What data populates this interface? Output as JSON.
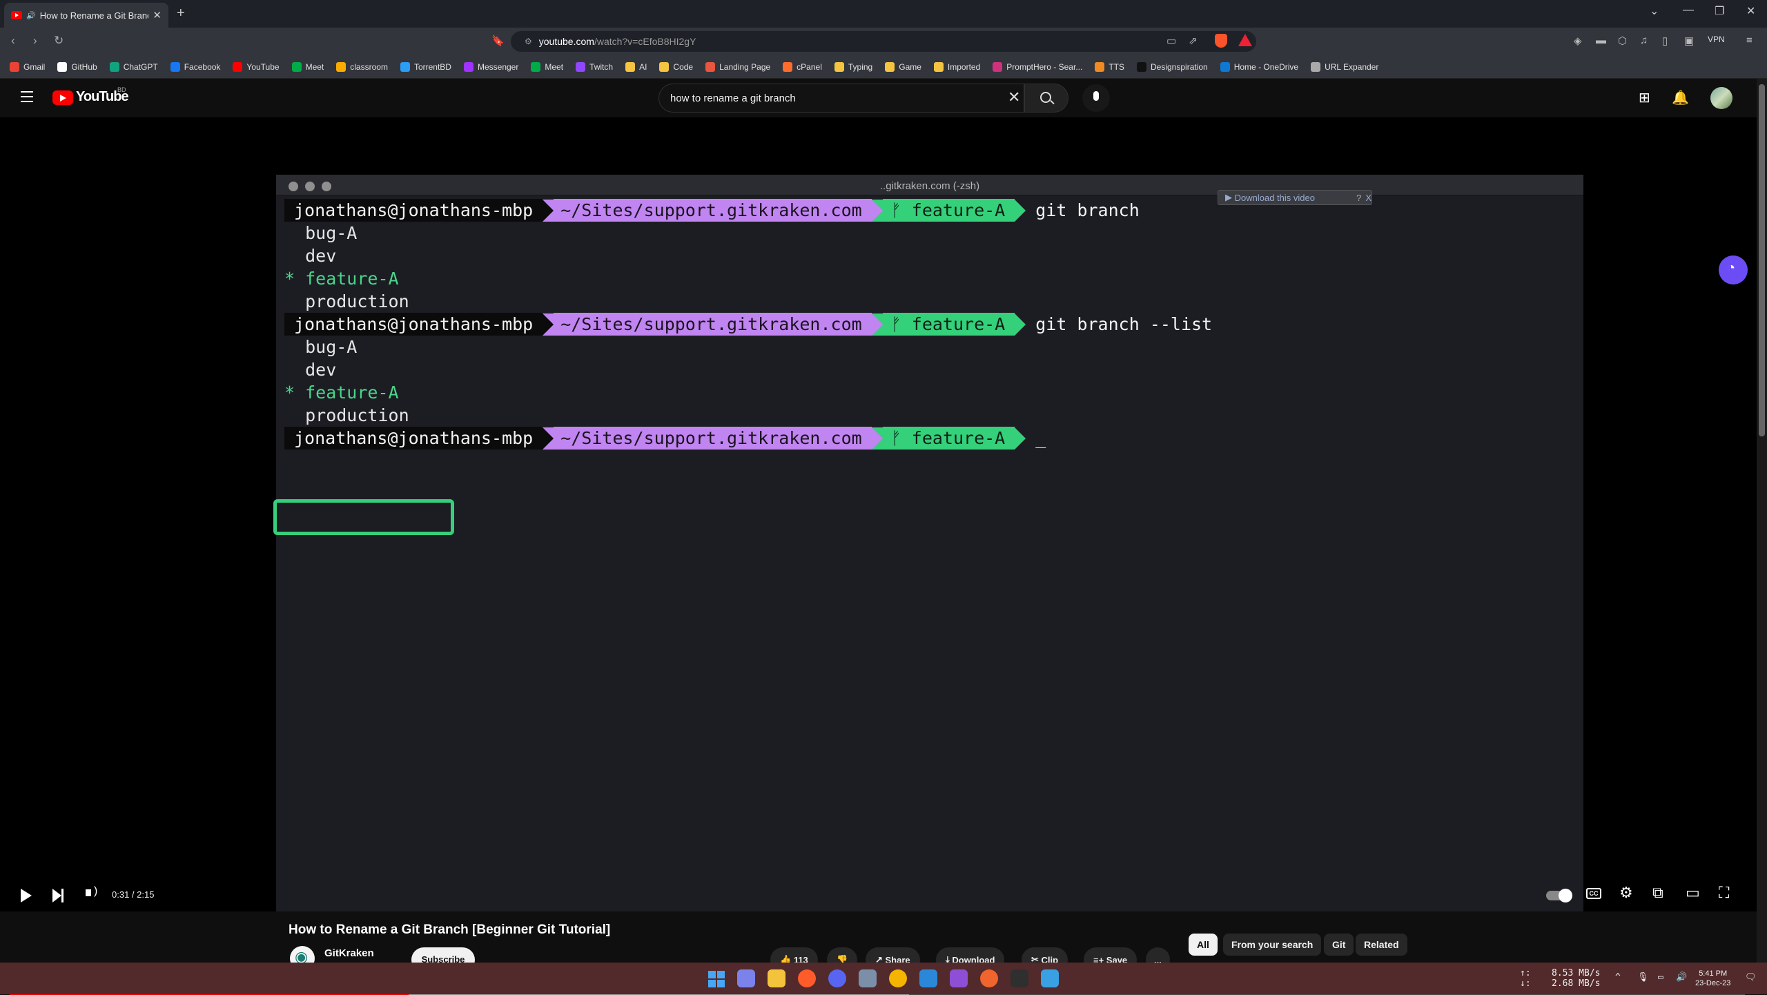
{
  "browser": {
    "tab_title": "How to Rename a Git Branch",
    "tab_audio_icon": "speaker-icon",
    "url_host": "youtube.com",
    "url_path": "/watch?v=cEfoB8HI2gY",
    "vpn_label": "VPN",
    "bookmarks": [
      {
        "label": "Gmail",
        "icon": "gmail-icon",
        "color": "#ea4335"
      },
      {
        "label": "GitHub",
        "icon": "github-icon",
        "color": "#ffffff"
      },
      {
        "label": "ChatGPT",
        "icon": "chatgpt-icon",
        "color": "#10a37f"
      },
      {
        "label": "Facebook",
        "icon": "facebook-icon",
        "color": "#1877f2"
      },
      {
        "label": "YouTube",
        "icon": "youtube-icon",
        "color": "#ff0000"
      },
      {
        "label": "Meet",
        "icon": "meet-icon",
        "color": "#00ac47"
      },
      {
        "label": "classroom",
        "icon": "classroom-icon",
        "color": "#f9ab00"
      },
      {
        "label": "TorrentBD",
        "icon": "torrentbd-icon",
        "color": "#2a9df4"
      },
      {
        "label": "Messenger",
        "icon": "messenger-icon",
        "color": "#a033ff"
      },
      {
        "label": "Meet",
        "icon": "meet-icon",
        "color": "#00ac47"
      },
      {
        "label": "Twitch",
        "icon": "twitch-icon",
        "color": "#9146ff"
      },
      {
        "label": "AI",
        "icon": "folder-icon",
        "color": "#f5c542"
      },
      {
        "label": "Code",
        "icon": "folder-icon",
        "color": "#f5c542"
      },
      {
        "label": "Landing Page",
        "icon": "landing-icon",
        "color": "#e8563f"
      },
      {
        "label": "cPanel",
        "icon": "cpanel-icon",
        "color": "#ff6c2c"
      },
      {
        "label": "Typing",
        "icon": "folder-icon",
        "color": "#f5c542"
      },
      {
        "label": "Game",
        "icon": "folder-icon",
        "color": "#f5c542"
      },
      {
        "label": "Imported",
        "icon": "folder-icon",
        "color": "#f5c542"
      },
      {
        "label": "PromptHero - Sear...",
        "icon": "prompthero-icon",
        "color": "#d0317f"
      },
      {
        "label": "TTS",
        "icon": "tts-icon",
        "color": "#f08a24"
      },
      {
        "label": "Designspiration",
        "icon": "designspiration-icon",
        "color": "#111111"
      },
      {
        "label": "Home - OneDrive",
        "icon": "onedrive-icon",
        "color": "#0f78d4"
      },
      {
        "label": "URL Expander",
        "icon": "url-expander-icon",
        "color": "#aaaaaa"
      }
    ]
  },
  "youtube": {
    "logo_text": "YouTube",
    "country_code": "BD",
    "search_query": "how to rename a git branch"
  },
  "terminal": {
    "window_title": "..gitkraken.com (-zsh)",
    "download_overlay": "Download this video",
    "download_overlay_q": "?",
    "download_overlay_x": "X",
    "prompt_user": "jonathans@jonathans-mbp",
    "prompt_path": "~/Sites/support.gitkraken.com",
    "prompt_branch": "feature-A",
    "branch_glyph": "ᚠ",
    "cmd1": "git branch",
    "cmd2": "git branch --list",
    "cursor": "_",
    "out1": [
      "  bug-A",
      "  dev",
      "* feature-A",
      "  production"
    ],
    "out2": [
      "  bug-A",
      "  dev",
      "* feature-A",
      "  production"
    ]
  },
  "player": {
    "time": "0:31 / 2:15",
    "progress_fraction": 0.23,
    "buffer_fraction": 0.52,
    "cc_label": "CC"
  },
  "video": {
    "title": "How to Rename a Git Branch [Beginner Git Tutorial]",
    "channel": "GitKraken",
    "subscribe": "Subscribe",
    "likes": "113",
    "share": "Share",
    "download": "Download",
    "clip": "Clip",
    "save": "Save",
    "more": "...",
    "chips": [
      "All",
      "From your search",
      "Git",
      "Related"
    ]
  },
  "taskbar": {
    "net_up": "8.53 MB/s",
    "net_down": "2.68 MB/s",
    "time": "5:41 PM",
    "date": "23-Dec-23"
  }
}
